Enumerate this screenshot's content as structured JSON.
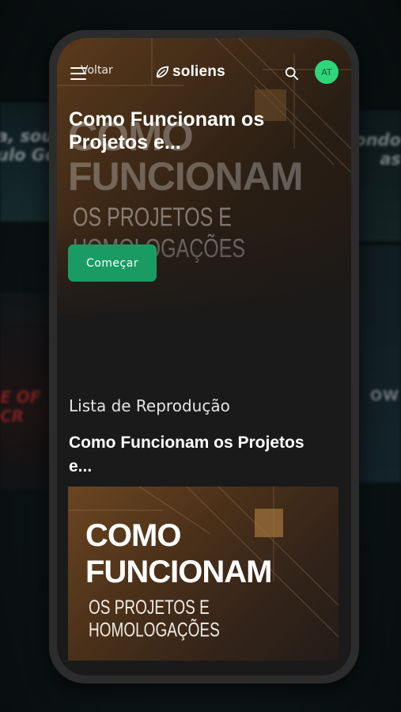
{
  "background": {
    "left_text": "a, sou\nulo Go",
    "right_text": "ondo\nas",
    "left_mid_text": "E OF\nCR",
    "right_mid_text": "OW"
  },
  "header": {
    "back_label": "Voltar",
    "logo_text": "soliens",
    "avatar_initials": "AT",
    "avatar_color": "#2dd67a",
    "icons": [
      "menu-icon",
      "leaf-logo-icon",
      "search-icon"
    ]
  },
  "hero": {
    "overlay_line1": "COMO",
    "overlay_line2": "FUNCIONAM",
    "overlay_line3": "OS PROJETOS E HOMOLOGAÇÕES",
    "title": "Como Funcionam os Projetos e...",
    "start_button": "Começar"
  },
  "playlist": {
    "heading": "Lista de Reprodução",
    "items": [
      {
        "title": "Como Funcionam os Projetos e...",
        "thumb_line1": "COMO",
        "thumb_line2": "FUNCIONAM",
        "thumb_line3": "OS PROJETOS E HOMOLOGAÇÕES"
      }
    ]
  },
  "colors": {
    "accent": "#1a9b63",
    "screen_bg": "#1a1a1a"
  }
}
